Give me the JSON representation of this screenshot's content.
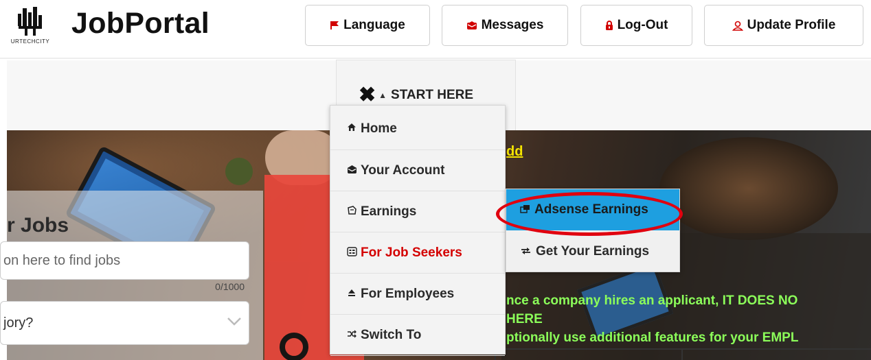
{
  "header": {
    "logo_caption": "URTECHCITY",
    "title": "JobPortal",
    "buttons": [
      {
        "label": "Language",
        "icon": "flag-icon"
      },
      {
        "label": "Messages",
        "icon": "envelope-icon"
      },
      {
        "label": "Log-Out",
        "icon": "lock-icon"
      },
      {
        "label": "Update Profile",
        "icon": "user-icon"
      }
    ]
  },
  "nav": {
    "start_label": "START HERE"
  },
  "menu": {
    "items": [
      {
        "label": "Home",
        "icon": "home-icon"
      },
      {
        "label": "Your Account",
        "icon": "envelope-open-icon"
      },
      {
        "label": "Earnings",
        "icon": "earnings-icon"
      },
      {
        "label": "For Job Seekers",
        "icon": "list-icon"
      },
      {
        "label": "For Employees",
        "icon": "eject-icon"
      },
      {
        "label": "Switch To",
        "icon": "shuffle-icon"
      }
    ],
    "submenu": [
      {
        "label": "Adsense Earnings",
        "icon": "external-window-icon"
      },
      {
        "label": "Get Your Earnings",
        "icon": "exchange-arrows-icon"
      }
    ]
  },
  "hero": {
    "section_title": "r Jobs",
    "search_placeholder": "on here to find jobs",
    "char_count": "0/1000",
    "category_text": "jory?",
    "link_text": "dd",
    "notices": [
      "nce a company hires an applicant, IT DOES NO",
      "HERE",
      "ptionally use additional features for your EMPL"
    ]
  },
  "colors": {
    "accent_red": "#d40000",
    "submenu_highlight": "#1e9fe0",
    "notice_green": "#8cff5a",
    "link_yellow": "#f5e500",
    "annotation_ring": "#e0000f"
  }
}
